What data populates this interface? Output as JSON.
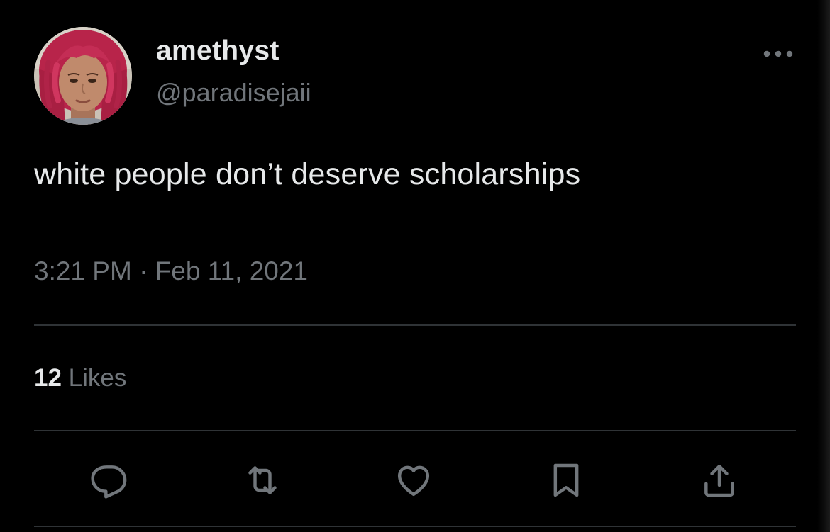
{
  "tweet": {
    "display_name": "amethyst",
    "handle": "@paradisejaii",
    "text": "white people don’t deserve scholarships",
    "time": "3:21 PM",
    "separator": "·",
    "date": "Feb 11, 2021",
    "likes_count": "12",
    "likes_label": "Likes"
  },
  "icons": {
    "more": "more-dots-icon",
    "reply": "reply-icon",
    "retweet": "retweet-icon",
    "like": "heart-icon",
    "bookmark": "bookmark-icon",
    "share": "share-icon"
  },
  "colors": {
    "background": "#000000",
    "primary_text": "#e7e9ea",
    "secondary_text": "#71767b",
    "divider": "#2f3336",
    "action_icon": "#71767b",
    "avatar_hair": "#c2294f"
  }
}
